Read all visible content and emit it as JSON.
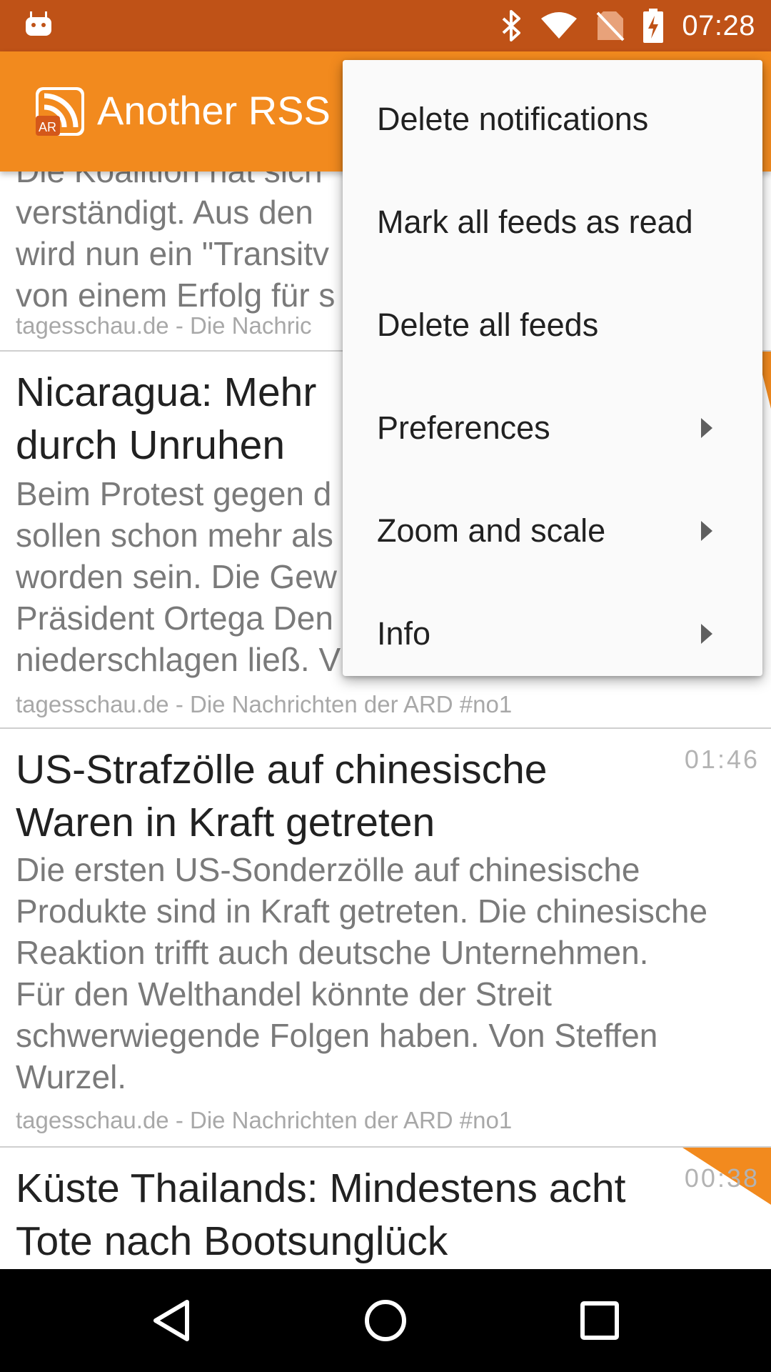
{
  "status_bar": {
    "time": "07:28",
    "icons": [
      "android-icon",
      "bluetooth-icon",
      "wifi-icon",
      "no-sim-icon",
      "battery-charging-icon"
    ]
  },
  "toolbar": {
    "title": "Another RSS",
    "logo_text": "AR",
    "color": "#f28a1e"
  },
  "feed": {
    "items": [
      {
        "headline": "",
        "summary_lines": [
          "Die Koalition hat sich",
          "verständigt. Aus den",
          "wird nun ein \"Transitv",
          "von einem Erfolg für s"
        ],
        "source": "tagesschau.de - Die Nachric",
        "time": ""
      },
      {
        "headline_lines": [
          "Nicaragua: Mehr",
          "durch Unruhen"
        ],
        "summary_lines": [
          "Beim Protest gegen d",
          "sollen schon mehr als",
          "worden sein. Die Gew",
          "Präsident Ortega Den",
          "niederschlagen ließ. V"
        ],
        "source": "tagesschau.de - Die Nachrichten der ARD #no1",
        "time": ""
      },
      {
        "headline_lines": [
          "US-Strafzölle auf chinesische",
          "Waren in Kraft getreten"
        ],
        "summary_lines": [
          "Die ersten US-Sonderzölle auf chinesische",
          "Produkte sind in Kraft getreten. Die chinesische",
          "Reaktion trifft auch deutsche Unternehmen.",
          "Für den Welthandel könnte der Streit",
          "schwerwiegende Folgen haben. Von Steffen",
          "Wurzel."
        ],
        "source": "tagesschau.de - Die Nachrichten der ARD #no1",
        "time": "01:46"
      },
      {
        "headline_lines": [
          "Küste Thailands: Mindestens acht",
          "Tote nach Bootsunglück"
        ],
        "source": "",
        "time": "00:38"
      }
    ]
  },
  "menu": {
    "items": [
      {
        "label": "Delete notifications",
        "submenu": false
      },
      {
        "label": "Mark all feeds as read",
        "submenu": false
      },
      {
        "label": "Delete all feeds",
        "submenu": false
      },
      {
        "label": "Preferences",
        "submenu": true
      },
      {
        "label": "Zoom and scale",
        "submenu": true
      },
      {
        "label": "Info",
        "submenu": true
      }
    ]
  },
  "nav_bar": {
    "buttons": [
      "back-icon",
      "home-icon",
      "recents-icon"
    ]
  }
}
